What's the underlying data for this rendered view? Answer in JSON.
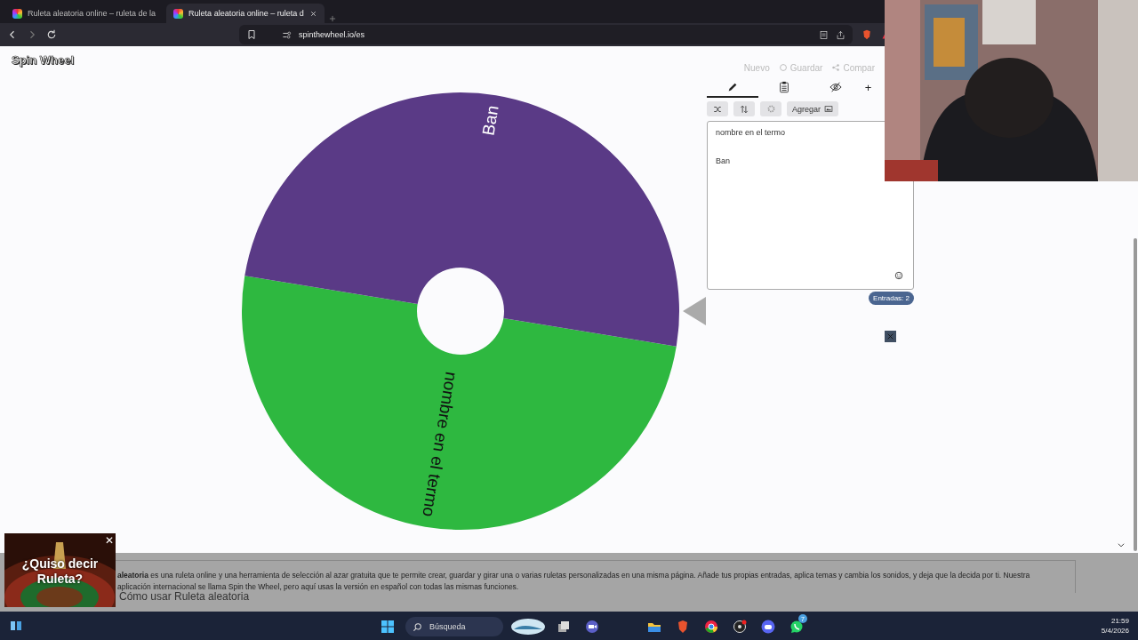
{
  "browser": {
    "tabs": [
      {
        "title": "Ruleta aleatoria online – ruleta de la",
        "selected": false
      },
      {
        "title": "Ruleta aleatoria online – ruleta d",
        "selected": true
      }
    ],
    "address": "spinthewheel.io/es"
  },
  "header": {
    "logo": "Spin Wheel",
    "actions": [
      "Nuevo",
      "Guardar",
      "Compar"
    ]
  },
  "wheel": {
    "segments": [
      {
        "label": "nombre en el termo",
        "color": "#2eb840"
      },
      {
        "label": "Ban",
        "color": "#5a3a86"
      }
    ]
  },
  "editor": {
    "tabs": [
      {
        "kind": "edit",
        "selected": true
      },
      {
        "kind": "list",
        "selected": false
      },
      {
        "kind": "hide",
        "selected": false
      },
      {
        "kind": "add",
        "label": "+",
        "selected": false
      }
    ],
    "add_button": "Agregar",
    "entries": [
      "nombre en el termo",
      "Ban"
    ],
    "count": "Entradas: 2"
  },
  "article": {
    "paragraph": "**aleatoria** es una ruleta online y una herramienta de selección al azar gratuita que te permite crear, guardar y girar una o varias ruletas personalizadas en una misma página. Añade tus propias entradas, aplica temas y cambia los sonidos, y deja que la decida por ti. Nuestra aplicación internacional se llama Spin the Wheel, pero aquí usas la versión en español con todas las mismas funciones.",
    "heading": "Cómo usar Ruleta aleatoria"
  },
  "ad": {
    "text": "¿Quiso decir Ruleta?",
    "close": "✕"
  },
  "taskbar": {
    "search": "Búsqueda",
    "time": "21:59",
    "date": "5/4/2026",
    "badge": "7"
  }
}
